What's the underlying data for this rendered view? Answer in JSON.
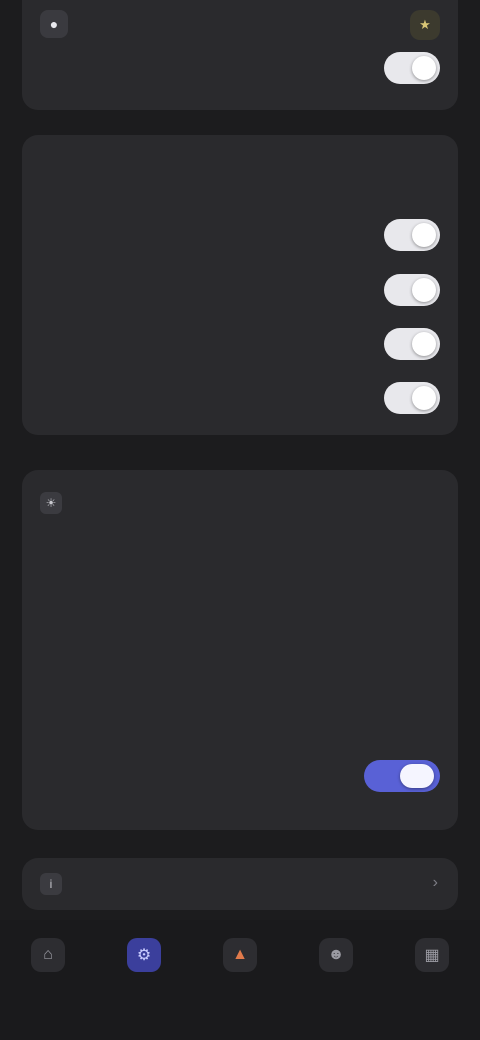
{
  "top": {
    "title": "",
    "icon": "person-icon",
    "badge_icon": "star-icon",
    "row_label": "",
    "toggle_on": true
  },
  "notifications": {
    "section_title": "",
    "rows": [
      {
        "label": "",
        "toggle_on": true
      },
      {
        "label": "",
        "toggle_on": true
      },
      {
        "label": "",
        "toggle_on": true
      },
      {
        "label": "",
        "toggle_on": true
      }
    ]
  },
  "display": {
    "section_title": "",
    "rows": [
      {
        "label": "",
        "value": ""
      },
      {
        "label": "",
        "value": ""
      }
    ],
    "long_label": "",
    "long_value": "",
    "toggle_label": "",
    "toggle_on": true
  },
  "about": {
    "title": "",
    "chevron": "chevron-right-icon"
  },
  "tabs": [
    {
      "label": "",
      "icon": "home-icon",
      "active": false
    },
    {
      "label": "",
      "icon": "settings-icon",
      "active": true
    },
    {
      "label": "",
      "icon": "fire-icon",
      "active": false
    },
    {
      "label": "",
      "icon": "user-icon",
      "active": false
    },
    {
      "label": "",
      "icon": "grid-icon",
      "active": false
    }
  ],
  "colors": {
    "accent": "#5961d6",
    "background": "#1c1c1e",
    "card": "#2a2a2d"
  }
}
